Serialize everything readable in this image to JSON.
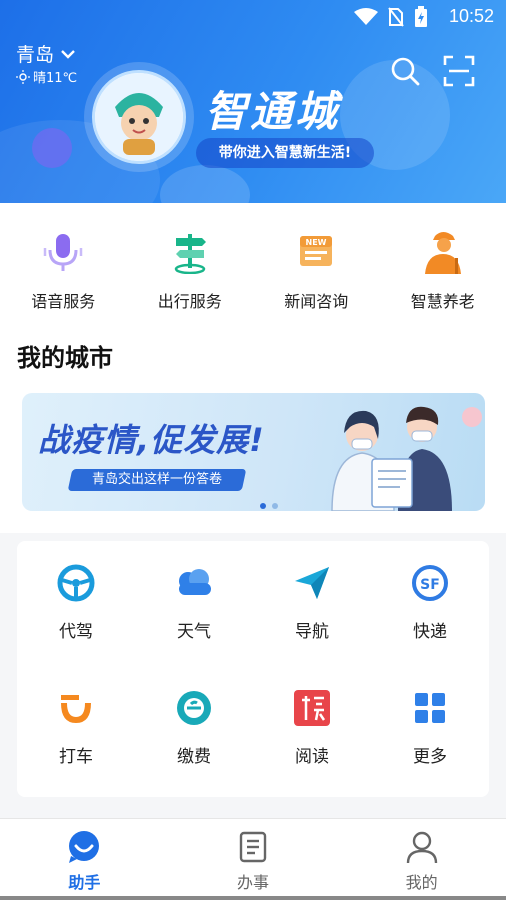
{
  "statusbar": {
    "time": "10:52"
  },
  "header": {
    "city": "青岛",
    "weather_text": "晴11℃",
    "brand_name": "智通城",
    "tagline": "带你进入智慧新生活!"
  },
  "services": [
    {
      "label": "语音服务",
      "icon": "microphone-icon",
      "color": "#8b6cf0"
    },
    {
      "label": "出行服务",
      "icon": "signpost-icon",
      "color": "#19b58a"
    },
    {
      "label": "新闻咨询",
      "icon": "news-icon",
      "color": "#f29b38"
    },
    {
      "label": "智慧养老",
      "icon": "elderly-icon",
      "color": "#f28a25"
    }
  ],
  "my_city": {
    "title": "我的城市",
    "banner": {
      "headline": "战疫情,促发展!",
      "sub": "青岛交出这样一份答卷"
    }
  },
  "apps": [
    {
      "label": "代驾",
      "icon": "steering-wheel-icon",
      "color": "#1a9bdc"
    },
    {
      "label": "天气",
      "icon": "cloud-icon",
      "color": "#2f80e8"
    },
    {
      "label": "导航",
      "icon": "paper-plane-icon",
      "color": "#1aa7d8"
    },
    {
      "label": "快递",
      "icon": "sf-express-icon",
      "color": "#2f7be3"
    },
    {
      "label": "打车",
      "icon": "didi-icon",
      "color": "#f5891f"
    },
    {
      "label": "缴费",
      "icon": "payment-icon",
      "color": "#19a9b8"
    },
    {
      "label": "阅读",
      "icon": "reading-icon",
      "color": "#e8454a"
    },
    {
      "label": "更多",
      "icon": "more-grid-icon",
      "color": "#2f80e8"
    }
  ],
  "tabbar": [
    {
      "label": "助手",
      "icon": "assistant-icon",
      "active": true
    },
    {
      "label": "办事",
      "icon": "tasks-icon",
      "active": false
    },
    {
      "label": "我的",
      "icon": "profile-icon",
      "active": false
    }
  ],
  "colors": {
    "accent": "#1f6fe5",
    "header_start": "#1d6fe8",
    "header_end": "#4aa7f7"
  }
}
